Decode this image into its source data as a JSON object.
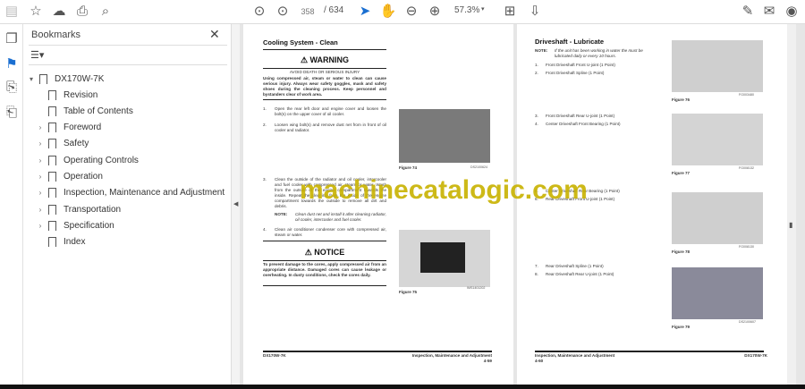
{
  "toolbar": {
    "page_current": "358",
    "page_total": "/ 634",
    "zoom": "57.3%"
  },
  "panel": {
    "title": "Bookmarks",
    "root": "DX170W-7K",
    "items": [
      "Revision",
      "Table of Contents",
      "Foreword",
      "Safety",
      "Operating Controls",
      "Operation",
      "Inspection, Maintenance and Adjustment",
      "Transportation",
      "Specification",
      "Index"
    ],
    "expandable": [
      false,
      false,
      true,
      true,
      true,
      true,
      true,
      true,
      true,
      false
    ]
  },
  "left_page": {
    "title": "Cooling System - Clean",
    "warning": "WARNING",
    "warning_sub": "AVOID DEATH OR SERIOUS INJURY",
    "warning_text": "Using compressed air, steam or water to clean can cause serious injury. Always wear safety goggles, mask and safety shoes during the cleaning process. Keep personnel and bystanders clear of work area.",
    "steps": [
      {
        "n": "1.",
        "t": "Open the rear left door and engine cover and loosen the bolt(s) on the upper cover of oil cooler."
      },
      {
        "n": "2.",
        "t": "Loosen wing bolt(s) and remove dust net from in front of oil cooler and radiator."
      },
      {
        "n": "3.",
        "t": "Clean the outside of the radiator and oil cooler, intercooler and fuel cooler with compressed air, steam or water. Wash from the outside of the engine compartment towards the inside. Repeat the cleaning from the inside of the engine compartment towards the outside to remove all dirt and debris."
      },
      {
        "n": "4.",
        "t": "Clean air conditioner condenser core with compressed air, steam or water."
      }
    ],
    "note_label": "NOTE:",
    "note": "Clean dust net and install it after cleaning radiator, oil cooler, intercooler and fuel cooler.",
    "notice": "NOTICE",
    "notice_text": "To prevent damage to the cores, apply compressed air from an appropriate distance. Damaged cores can cause leakage or overheating. In dusty conditions, check the cores daily.",
    "fig74": "Figure 74",
    "fig74_code": "DS2100624",
    "fig75": "Figure 75",
    "fig75_code": "IMS1401202",
    "footer_left": "DX170W-7K",
    "footer_right": "Inspection, Maintenance and Adjustment",
    "footer_page": "4-59"
  },
  "right_page": {
    "title": "Driveshaft - Lubricate",
    "note_label": "NOTE:",
    "note": "If the unit has been working in water the must be lubricated daily or every 10 hours.",
    "steps": [
      "Front Driveshaft Front U-joint (1 Point)",
      "Front Driveshaft Spline (1 Point)",
      "Front Driveshaft Rear U-joint (1 Point)",
      "Center Driveshaft Front Bearing (1 Point)",
      "Center Driveshaft Rear Bearing (1 Point)",
      "Rear Driveshaft Front U-joint (1 Point)",
      "Rear Driveshaft Spline (1 Point)",
      "Rear Driveshaft Rear U-joint (1 Point)"
    ],
    "figs": [
      "Figure 76",
      "Figure 77",
      "Figure 78",
      "Figure 79"
    ],
    "codes": [
      "FG003480",
      "FG008132",
      "FG008130",
      "DS2100607"
    ],
    "footer_left": "Inspection, Maintenance and Adjustment",
    "footer_page": "4-60",
    "footer_right": "DX170W-7K"
  },
  "watermark": "machinecatalogic.com"
}
